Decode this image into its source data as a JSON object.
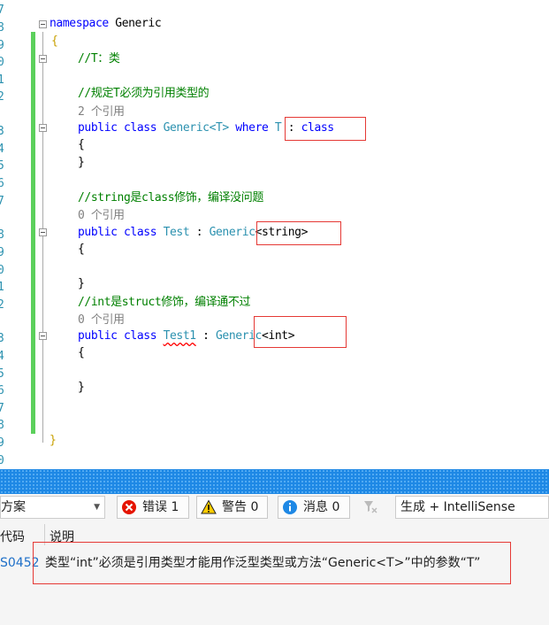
{
  "editor": {
    "lines": [
      {
        "num": "7"
      },
      {
        "num": "8"
      },
      {
        "num": "9"
      },
      {
        "num": "0"
      },
      {
        "num": "1"
      },
      {
        "num": "2"
      },
      {
        "num": "3"
      },
      {
        "num": "4"
      },
      {
        "num": "5"
      },
      {
        "num": "6"
      },
      {
        "num": "7"
      },
      {
        "num": "8"
      },
      {
        "num": "9"
      },
      {
        "num": "0"
      },
      {
        "num": "1"
      },
      {
        "num": "2"
      },
      {
        "num": "3"
      },
      {
        "num": "4"
      },
      {
        "num": "5"
      },
      {
        "num": "6"
      },
      {
        "num": "7"
      },
      {
        "num": "8"
      },
      {
        "num": "9"
      },
      {
        "num": "0"
      }
    ],
    "ns_kw": "namespace",
    "ns_name": "Generic",
    "open_brace": "{",
    "close_brace": "}",
    "comment_t": "//T：类",
    "comment_rule": "//规定T必须为引用类型的",
    "refs_generic": "2 个引用",
    "refs_test": "0 个引用",
    "refs_test1": "0 个引用",
    "kw_public": "public",
    "kw_class": "class",
    "kw_where": "where",
    "generic_decl": "Generic<T>",
    "constraint_t": "T",
    "constraint_colon": " : ",
    "constraint_class": "class",
    "comment_string": "//string是class修饰，编译没问题",
    "test_name": "Test",
    "colon": " : ",
    "generic_base": "Generic",
    "string_arg": "<string>",
    "comment_int": "//int是struct修饰，编译通不过",
    "test1_name": "Test1",
    "int_arg": "<int>"
  },
  "error_list": {
    "scope_value": "方案",
    "errors_label": "错误 1",
    "warnings_label": "警告 0",
    "messages_label": "消息 0",
    "build_filter": "生成 + IntelliSense",
    "col_code": "代码",
    "col_desc": "说明",
    "error_code": "S0452",
    "error_desc": "类型“int”必须是引用类型才能用作泛型类型或方法“Generic<T>”中的参数“T”"
  },
  "colors": {
    "keyword": "#0000ff",
    "type": "#2b91af",
    "comment": "#008000",
    "error_red": "#e53935",
    "changes_green": "#5cd05c",
    "splitter_blue": "#1e88e5"
  }
}
